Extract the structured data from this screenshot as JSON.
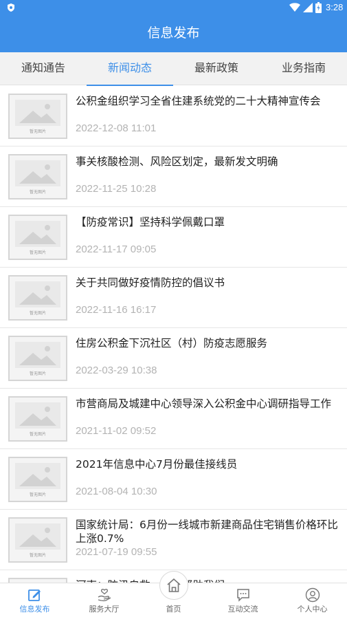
{
  "status_bar": {
    "time": "3:28"
  },
  "header": {
    "title": "信息发布"
  },
  "tabs": [
    {
      "label": "通知通告",
      "active": false
    },
    {
      "label": "新闻动态",
      "active": true
    },
    {
      "label": "最新政策",
      "active": false
    },
    {
      "label": "业务指南",
      "active": false
    }
  ],
  "thumbnail_placeholder": "暂无图片",
  "news": [
    {
      "title": "公积金组织学习全省住建系统党的二十大精神宣传会",
      "date": "2022-12-08 11:01"
    },
    {
      "title": "事关核酸检测、风险区划定，最新发文明确",
      "date": "2022-11-25 10:28"
    },
    {
      "title": "【防疫常识】坚持科学佩戴口罩",
      "date": "2022-11-17 09:05"
    },
    {
      "title": "关于共同做好疫情防控的倡议书",
      "date": "2022-11-16 16:17"
    },
    {
      "title": "住房公积金下沉社区（村）防疫志愿服务",
      "date": "2022-03-29 10:38"
    },
    {
      "title": "市营商局及城建中心领导深入公积金中心调研指导工作",
      "date": "2021-11-02 09:52"
    },
    {
      "title": "2021年信息中心7月份最佳接线员",
      "date": "2021-08-04 10:30"
    },
    {
      "title": "国家统计局：6月份一线城市新建商品住宅销售价格环比上涨0.7%",
      "date": "2021-07-19 09:55"
    },
    {
      "title": "河南：防汛自救，互相帮助我们",
      "date": ""
    }
  ],
  "bottom_nav": [
    {
      "label": "信息发布",
      "icon": "edit-icon",
      "active": true
    },
    {
      "label": "服务大厅",
      "icon": "hand-heart-icon",
      "active": false
    },
    {
      "label": "首页",
      "icon": "home-icon",
      "active": false
    },
    {
      "label": "互动交流",
      "icon": "chat-icon",
      "active": false
    },
    {
      "label": "个人中心",
      "icon": "user-icon",
      "active": false
    }
  ],
  "colors": {
    "primary": "#3d8fe8",
    "date_gray": "#b3b3b3"
  }
}
